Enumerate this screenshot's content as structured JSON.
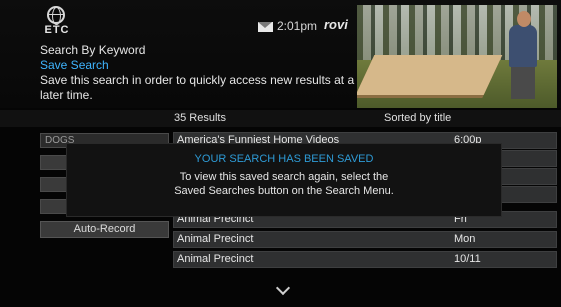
{
  "header": {
    "logo_text": "ETC",
    "time": "2:01pm",
    "brand": "rovi",
    "title": "Search By Keyword",
    "subtitle": "Save Search",
    "description": "Save this search in order to quickly access new results at a later time."
  },
  "results": {
    "count_label": "35 Results",
    "sort_label": "Sorted by title",
    "rows": [
      {
        "title": "America's Funniest Home Videos",
        "date": "6:00p"
      },
      {
        "title": "Animal Precinct",
        "date": "Fri"
      },
      {
        "title": "Animal Precinct",
        "date": "Mon"
      },
      {
        "title": "Animal Precinct",
        "date": "10/11"
      }
    ]
  },
  "left_menu": {
    "keyword_value": "DOGS",
    "auto_record_label": "Auto-Record"
  },
  "dialog": {
    "title": "YOUR SEARCH HAS BEEN SAVED",
    "line1": "To view this saved search again, select the",
    "line2": "Saved Searches button on the Search Menu."
  },
  "icons": {
    "logo": "globe-logo-icon",
    "mail": "mail-icon",
    "scroll": "chevron-down-icon"
  }
}
